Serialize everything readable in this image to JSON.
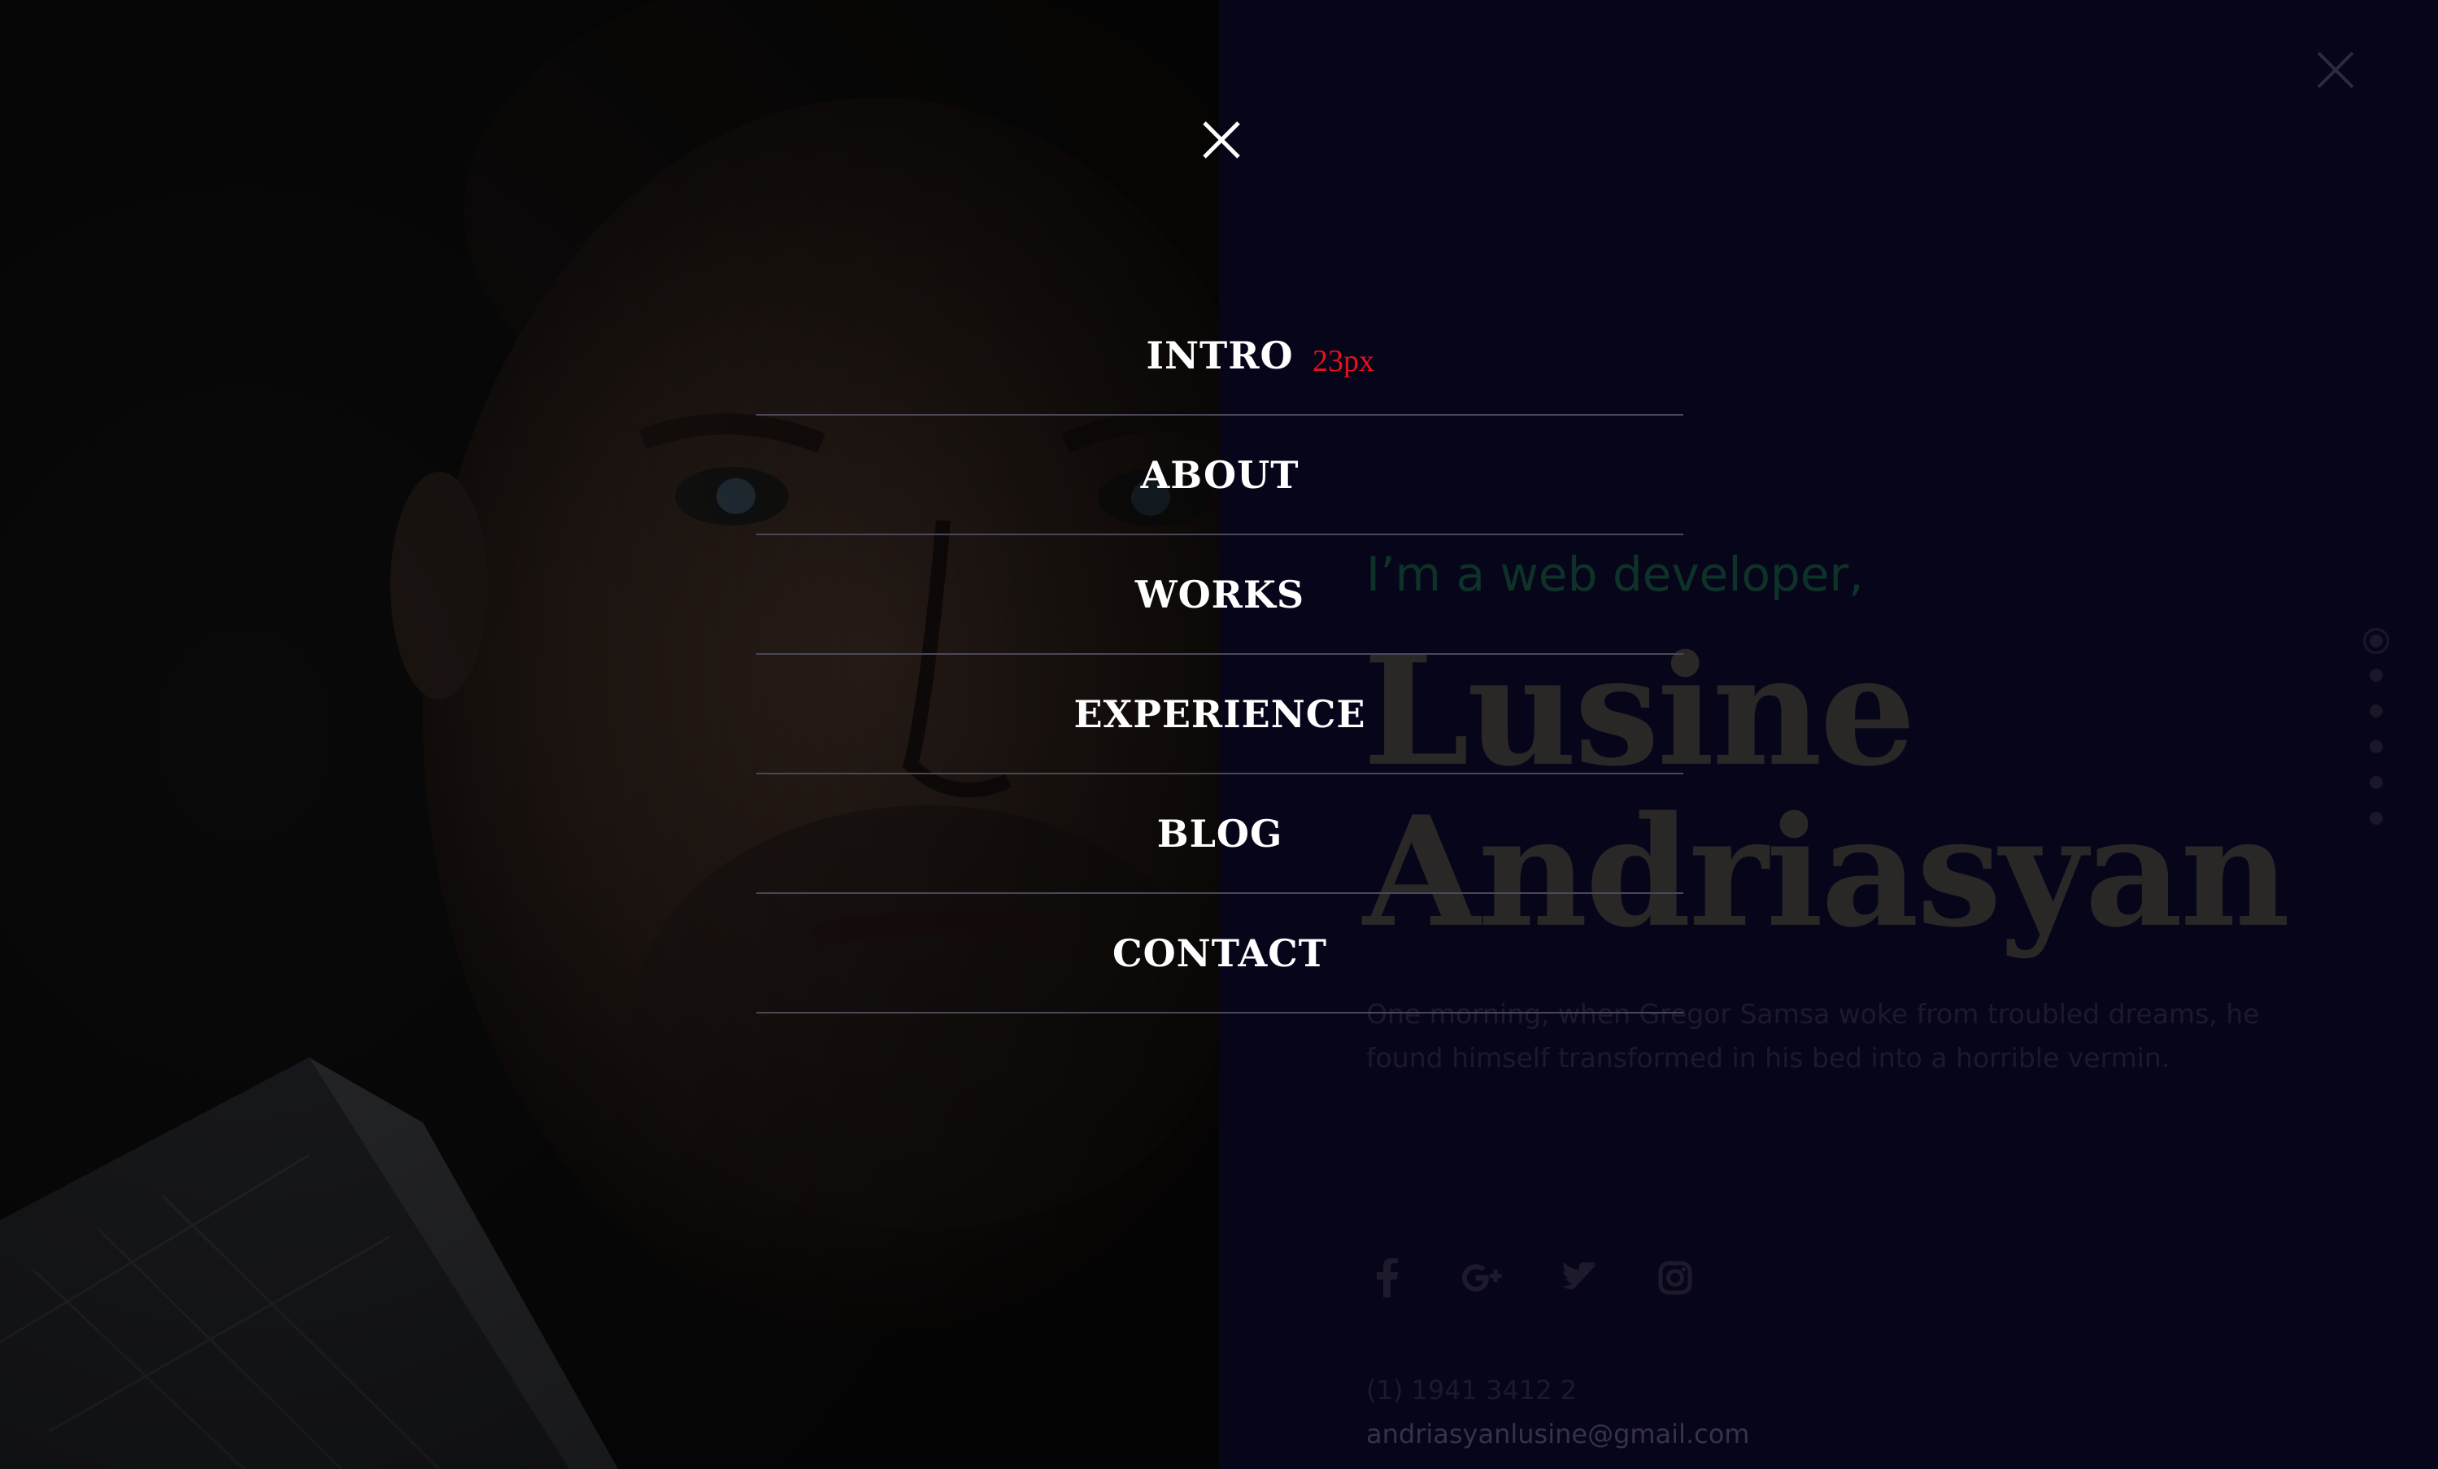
{
  "hero": {
    "subtitle": "I’m a web developer,",
    "name_line1": "Lusine",
    "name_line2": "Andriasyan",
    "description": "One morning, when Gregor Samsa woke from troubled dreams, he found himself transformed in his bed into a horrible vermin."
  },
  "social": {
    "icons": [
      "facebook-icon",
      "google-plus-icon",
      "twitter-icon",
      "instagram-icon"
    ]
  },
  "contact": {
    "phone": "(1) 1941 3412 2",
    "email": "andriasyanlusine@gmail.com"
  },
  "menu": {
    "items": [
      {
        "label": "INTRO"
      },
      {
        "label": "ABOUT"
      },
      {
        "label": "WORKS"
      },
      {
        "label": "EXPERIENCE"
      },
      {
        "label": "BLOG"
      },
      {
        "label": "CONTACT"
      }
    ],
    "annotation": "23px"
  },
  "dot_nav": {
    "count": 6,
    "active_index": 0
  },
  "colors": {
    "background": "#07051a",
    "menu_text": "#ffffff",
    "annotation": "#e8101c",
    "subtitle": "#0d3328"
  }
}
